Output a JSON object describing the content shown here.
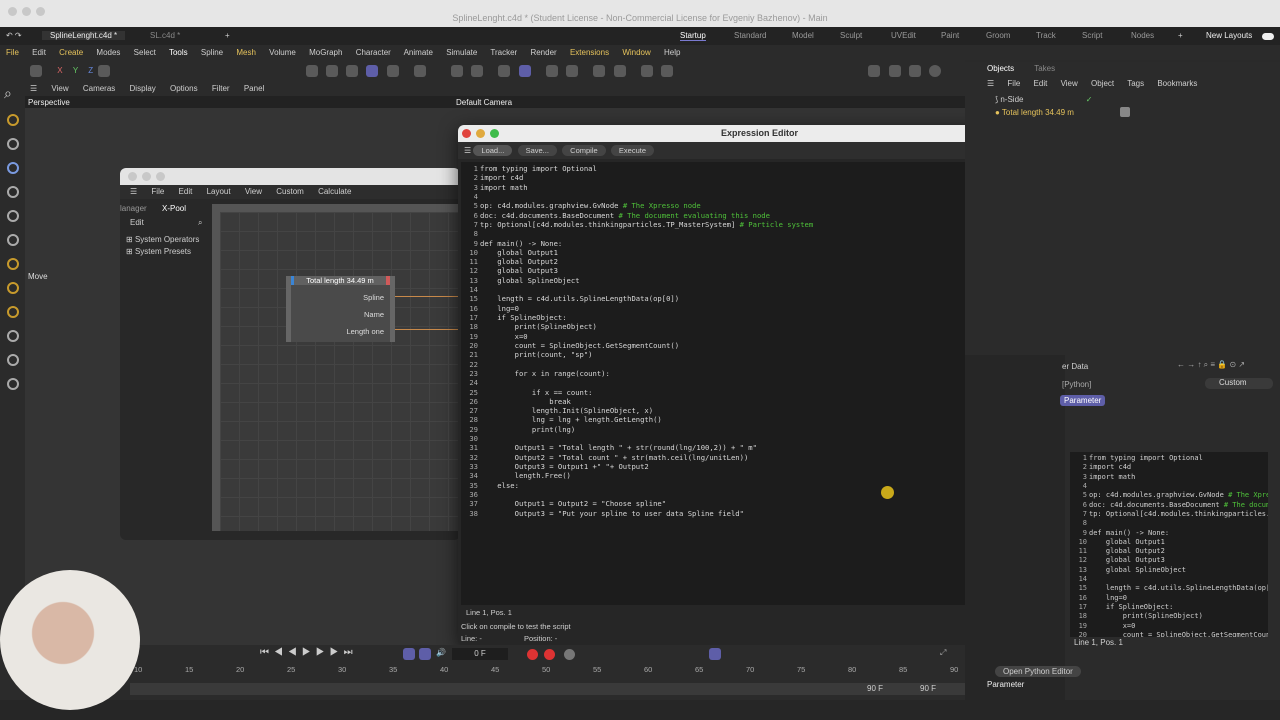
{
  "window_title": "SplineLenght.c4d * (Student License - Non-Commercial License for Evgeniy Bazhenov) - Main",
  "doc_tabs": [
    "SplineLenght.c4d *",
    "SL.c4d *"
  ],
  "layouts": [
    "Startup",
    "Standard",
    "Model",
    "Sculpt",
    "UVEdit",
    "Paint",
    "Groom",
    "Track",
    "Script",
    "Nodes"
  ],
  "new_layouts_label": "New Layouts",
  "menu": [
    "File",
    "Edit",
    "Create",
    "Modes",
    "Select",
    "Tools",
    "Spline",
    "Mesh",
    "Volume",
    "MoGraph",
    "Character",
    "Animate",
    "Simulate",
    "Tracker",
    "Render",
    "Extensions",
    "Window",
    "Help"
  ],
  "viewport": {
    "menu": [
      "View",
      "Cameras",
      "Display",
      "Options",
      "Filter",
      "Panel"
    ],
    "label": "Perspective",
    "camera": "Default Camera",
    "move_label": "Move"
  },
  "objects": {
    "tabs": [
      "Objects",
      "Takes"
    ],
    "menu": [
      "File",
      "Edit",
      "View",
      "Object",
      "Tags",
      "Bookmarks"
    ],
    "items": [
      "n-Side",
      "Total length 34.49 m"
    ]
  },
  "xpresso": {
    "menu": [
      "File",
      "Edit",
      "Layout",
      "View",
      "Custom",
      "Calculate"
    ],
    "tabs": [
      "lanager",
      "X-Pool"
    ],
    "edit": "Edit",
    "tree": [
      "System Operators",
      "System Presets"
    ],
    "node": {
      "title": "Total length 34.49 m",
      "ports": [
        "Spline",
        "Name",
        "Length one"
      ]
    }
  },
  "editor": {
    "title": "Expression Editor",
    "buttons": [
      "Load...",
      "Save...",
      "Compile",
      "Execute"
    ],
    "status": "Line 1, Pos. 1",
    "hint": "Click on compile to test the script",
    "line_label": "Line: -",
    "position_label": "Position: -",
    "code": [
      "from typing import Optional",
      "import c4d",
      "import math",
      "",
      "op: c4d.modules.graphview.GvNode # The Xpresso node",
      "doc: c4d.documents.BaseDocument # The document evaluating this node",
      "tp: Optional[c4d.modules.thinkingparticles.TP_MasterSystem] # Particle system",
      "",
      "def main() -> None:",
      "    global Output1",
      "    global Output2",
      "    global Output3",
      "    global SplineObject",
      "",
      "    length = c4d.utils.SplineLengthData(op[0])",
      "    lng=0",
      "    if SplineObject:",
      "        print(SplineObject)",
      "        x=0",
      "        count = SplineObject.GetSegmentCount()",
      "        print(count, \"sp\")",
      "",
      "        for x in range(count):",
      "",
      "            if x == count:",
      "                break",
      "            length.Init(SplineObject, x)",
      "            lng = lng + length.GetLength()",
      "            print(lng)",
      "",
      "        Output1 = \"Total length \" + str(round(lng/100,2)) + \" m\"",
      "        Output2 = \"Total count \" + str(math.ceil(lng/unitLen))",
      "        Output3 = Output1 +\" \"+ Output2",
      "        length.Free()",
      "    else:",
      "",
      "        Output1 = Output2 = \"Choose spline\"",
      "        Output3 = \"Put your spline to user data Spline field\""
    ]
  },
  "attributes": {
    "header": "er Data",
    "python_label": "[Python]",
    "mode": "Custom",
    "parameter_tab": "Parameter",
    "status": "Line 1, Pos. 1",
    "open_editor": "Open Python Editor",
    "parameter_label": "Parameter"
  },
  "timeline": {
    "frame": "0 F",
    "ticks": [
      "10",
      "15",
      "20",
      "25",
      "30",
      "35",
      "40",
      "45",
      "50",
      "55",
      "60",
      "65",
      "70",
      "75",
      "80",
      "85",
      "90"
    ],
    "end1": "90 F",
    "end2": "90 F"
  },
  "colors": {
    "accent": "#5e5ea8",
    "comment": "#4fc23a",
    "highlight": "#e6c35c"
  }
}
